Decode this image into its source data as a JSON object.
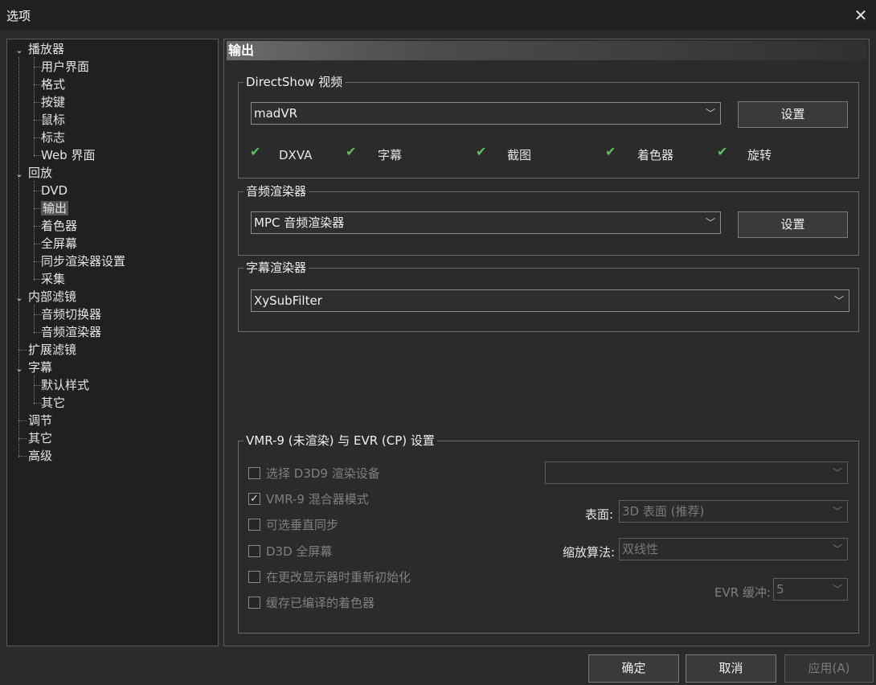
{
  "window": {
    "title": "选项",
    "close_icon": "close-icon"
  },
  "tree": [
    {
      "label": "播放器",
      "expanded": true
    },
    {
      "label": "用户界面"
    },
    {
      "label": "格式"
    },
    {
      "label": "按键"
    },
    {
      "label": "鼠标"
    },
    {
      "label": "标志"
    },
    {
      "label": "Web 界面"
    },
    {
      "label": "回放",
      "expanded": true
    },
    {
      "label": "DVD"
    },
    {
      "label": "输出",
      "selected": true
    },
    {
      "label": "着色器"
    },
    {
      "label": "全屏幕"
    },
    {
      "label": "同步渲染器设置"
    },
    {
      "label": "采集"
    },
    {
      "label": "内部滤镜",
      "expanded": true
    },
    {
      "label": "音频切换器"
    },
    {
      "label": "音频渲染器"
    },
    {
      "label": "扩展滤镜"
    },
    {
      "label": "字幕",
      "expanded": true
    },
    {
      "label": "默认样式"
    },
    {
      "label": "其它"
    },
    {
      "label": "调节"
    },
    {
      "label": "其它"
    },
    {
      "label": "高级"
    }
  ],
  "panel": {
    "header": "输出",
    "directshow": {
      "legend": "DirectShow 视频",
      "value": "madVR",
      "settings_label": "设置",
      "capabilities": [
        "DXVA",
        "字幕",
        "截图",
        "着色器",
        "旋转"
      ]
    },
    "audio": {
      "legend": "音频渲染器",
      "value": "MPC 音频渲染器",
      "settings_label": "设置"
    },
    "subtitle": {
      "legend": "字幕渲染器",
      "value": "XySubFilter"
    },
    "vmr": {
      "legend": "VMR-9 (未渲染) 与 EVR (CP) 设置",
      "checkboxes": [
        {
          "label": "选择 D3D9 渲染设备",
          "checked": false
        },
        {
          "label": "VMR-9 混合器模式",
          "checked": true
        },
        {
          "label": "可选垂直同步",
          "checked": false
        },
        {
          "label": "D3D 全屏幕",
          "checked": false
        },
        {
          "label": "在更改显示器时重新初始化",
          "checked": false
        },
        {
          "label": "缓存已编译的着色器",
          "checked": false
        }
      ],
      "device_value": "",
      "surface_label": "表面:",
      "surface_value": "3D 表面 (推荐)",
      "resize_label": "缩放算法:",
      "resize_value": "双线性",
      "evr_label": "EVR 缓冲:",
      "evr_value": "5"
    }
  },
  "footer": {
    "ok_label": "确定",
    "cancel_label": "取消",
    "apply_label": "应用(A)"
  }
}
